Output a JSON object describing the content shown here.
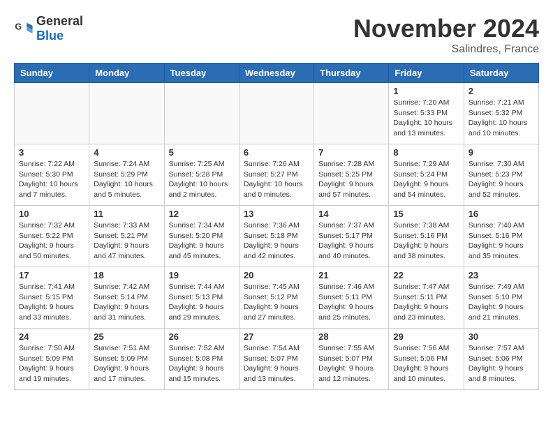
{
  "header": {
    "logo_general": "General",
    "logo_blue": "Blue",
    "month_title": "November 2024",
    "location": "Salindres, France"
  },
  "weekdays": [
    "Sunday",
    "Monday",
    "Tuesday",
    "Wednesday",
    "Thursday",
    "Friday",
    "Saturday"
  ],
  "weeks": [
    [
      {
        "day": "",
        "content": ""
      },
      {
        "day": "",
        "content": ""
      },
      {
        "day": "",
        "content": ""
      },
      {
        "day": "",
        "content": ""
      },
      {
        "day": "",
        "content": ""
      },
      {
        "day": "1",
        "content": "Sunrise: 7:20 AM\nSunset: 5:33 PM\nDaylight: 10 hours\nand 13 minutes."
      },
      {
        "day": "2",
        "content": "Sunrise: 7:21 AM\nSunset: 5:32 PM\nDaylight: 10 hours\nand 10 minutes."
      }
    ],
    [
      {
        "day": "3",
        "content": "Sunrise: 7:22 AM\nSunset: 5:30 PM\nDaylight: 10 hours\nand 7 minutes."
      },
      {
        "day": "4",
        "content": "Sunrise: 7:24 AM\nSunset: 5:29 PM\nDaylight: 10 hours\nand 5 minutes."
      },
      {
        "day": "5",
        "content": "Sunrise: 7:25 AM\nSunset: 5:28 PM\nDaylight: 10 hours\nand 2 minutes."
      },
      {
        "day": "6",
        "content": "Sunrise: 7:26 AM\nSunset: 5:27 PM\nDaylight: 10 hours\nand 0 minutes."
      },
      {
        "day": "7",
        "content": "Sunrise: 7:28 AM\nSunset: 5:25 PM\nDaylight: 9 hours\nand 57 minutes."
      },
      {
        "day": "8",
        "content": "Sunrise: 7:29 AM\nSunset: 5:24 PM\nDaylight: 9 hours\nand 54 minutes."
      },
      {
        "day": "9",
        "content": "Sunrise: 7:30 AM\nSunset: 5:23 PM\nDaylight: 9 hours\nand 52 minutes."
      }
    ],
    [
      {
        "day": "10",
        "content": "Sunrise: 7:32 AM\nSunset: 5:22 PM\nDaylight: 9 hours\nand 50 minutes."
      },
      {
        "day": "11",
        "content": "Sunrise: 7:33 AM\nSunset: 5:21 PM\nDaylight: 9 hours\nand 47 minutes."
      },
      {
        "day": "12",
        "content": "Sunrise: 7:34 AM\nSunset: 5:20 PM\nDaylight: 9 hours\nand 45 minutes."
      },
      {
        "day": "13",
        "content": "Sunrise: 7:36 AM\nSunset: 5:18 PM\nDaylight: 9 hours\nand 42 minutes."
      },
      {
        "day": "14",
        "content": "Sunrise: 7:37 AM\nSunset: 5:17 PM\nDaylight: 9 hours\nand 40 minutes."
      },
      {
        "day": "15",
        "content": "Sunrise: 7:38 AM\nSunset: 5:16 PM\nDaylight: 9 hours\nand 38 minutes."
      },
      {
        "day": "16",
        "content": "Sunrise: 7:40 AM\nSunset: 5:16 PM\nDaylight: 9 hours\nand 35 minutes."
      }
    ],
    [
      {
        "day": "17",
        "content": "Sunrise: 7:41 AM\nSunset: 5:15 PM\nDaylight: 9 hours\nand 33 minutes."
      },
      {
        "day": "18",
        "content": "Sunrise: 7:42 AM\nSunset: 5:14 PM\nDaylight: 9 hours\nand 31 minutes."
      },
      {
        "day": "19",
        "content": "Sunrise: 7:44 AM\nSunset: 5:13 PM\nDaylight: 9 hours\nand 29 minutes."
      },
      {
        "day": "20",
        "content": "Sunrise: 7:45 AM\nSunset: 5:12 PM\nDaylight: 9 hours\nand 27 minutes."
      },
      {
        "day": "21",
        "content": "Sunrise: 7:46 AM\nSunset: 5:11 PM\nDaylight: 9 hours\nand 25 minutes."
      },
      {
        "day": "22",
        "content": "Sunrise: 7:47 AM\nSunset: 5:11 PM\nDaylight: 9 hours\nand 23 minutes."
      },
      {
        "day": "23",
        "content": "Sunrise: 7:49 AM\nSunset: 5:10 PM\nDaylight: 9 hours\nand 21 minutes."
      }
    ],
    [
      {
        "day": "24",
        "content": "Sunrise: 7:50 AM\nSunset: 5:09 PM\nDaylight: 9 hours\nand 19 minutes."
      },
      {
        "day": "25",
        "content": "Sunrise: 7:51 AM\nSunset: 5:09 PM\nDaylight: 9 hours\nand 17 minutes."
      },
      {
        "day": "26",
        "content": "Sunrise: 7:52 AM\nSunset: 5:08 PM\nDaylight: 9 hours\nand 15 minutes."
      },
      {
        "day": "27",
        "content": "Sunrise: 7:54 AM\nSunset: 5:07 PM\nDaylight: 9 hours\nand 13 minutes."
      },
      {
        "day": "28",
        "content": "Sunrise: 7:55 AM\nSunset: 5:07 PM\nDaylight: 9 hours\nand 12 minutes."
      },
      {
        "day": "29",
        "content": "Sunrise: 7:56 AM\nSunset: 5:06 PM\nDaylight: 9 hours\nand 10 minutes."
      },
      {
        "day": "30",
        "content": "Sunrise: 7:57 AM\nSunset: 5:06 PM\nDaylight: 9 hours\nand 8 minutes."
      }
    ]
  ]
}
